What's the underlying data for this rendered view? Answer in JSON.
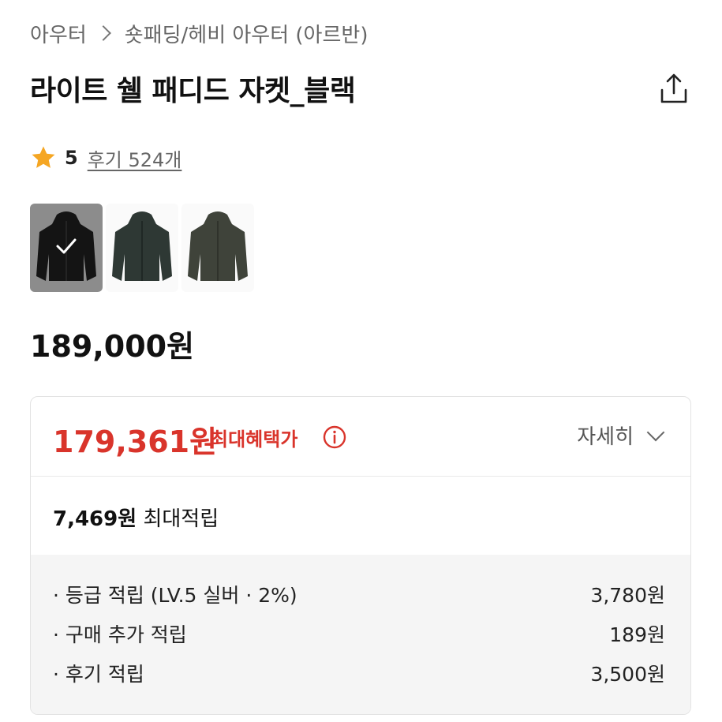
{
  "breadcrumb": {
    "level1": "아우터",
    "level2": "숏패딩/헤비 아우터 (아르반)"
  },
  "product": {
    "title": "라이트 쉘 패디드 자켓_블랙",
    "rating": "5",
    "reviews_label": "후기 524개",
    "price": "189,000원"
  },
  "swatches": [
    {
      "color": "블랙",
      "fill": "#151515",
      "selected": true
    },
    {
      "color": "차콜 그린",
      "fill": "#2e3834",
      "selected": false
    },
    {
      "color": "카키",
      "fill": "#3f433a",
      "selected": false
    }
  ],
  "benefit": {
    "max_price": "179,361원",
    "max_label": "최대혜택가",
    "detail_label": "자세히",
    "points_total_amount": "7,469원",
    "points_total_label": "최대적립",
    "rows": [
      {
        "label": "· 등급 적립 (LV.5 실버 · 2%)",
        "value": "3,780원"
      },
      {
        "label": "· 구매 추가 적립",
        "value": "189원"
      },
      {
        "label": "· 후기 적립",
        "value": "3,500원"
      }
    ]
  },
  "colors": {
    "accent_red": "#d9342b",
    "star": "#f5a623"
  },
  "icons": {
    "share": "share-icon",
    "star": "star-icon",
    "info": "info-icon",
    "check": "check-icon",
    "chevron": "chevron-down-icon"
  }
}
